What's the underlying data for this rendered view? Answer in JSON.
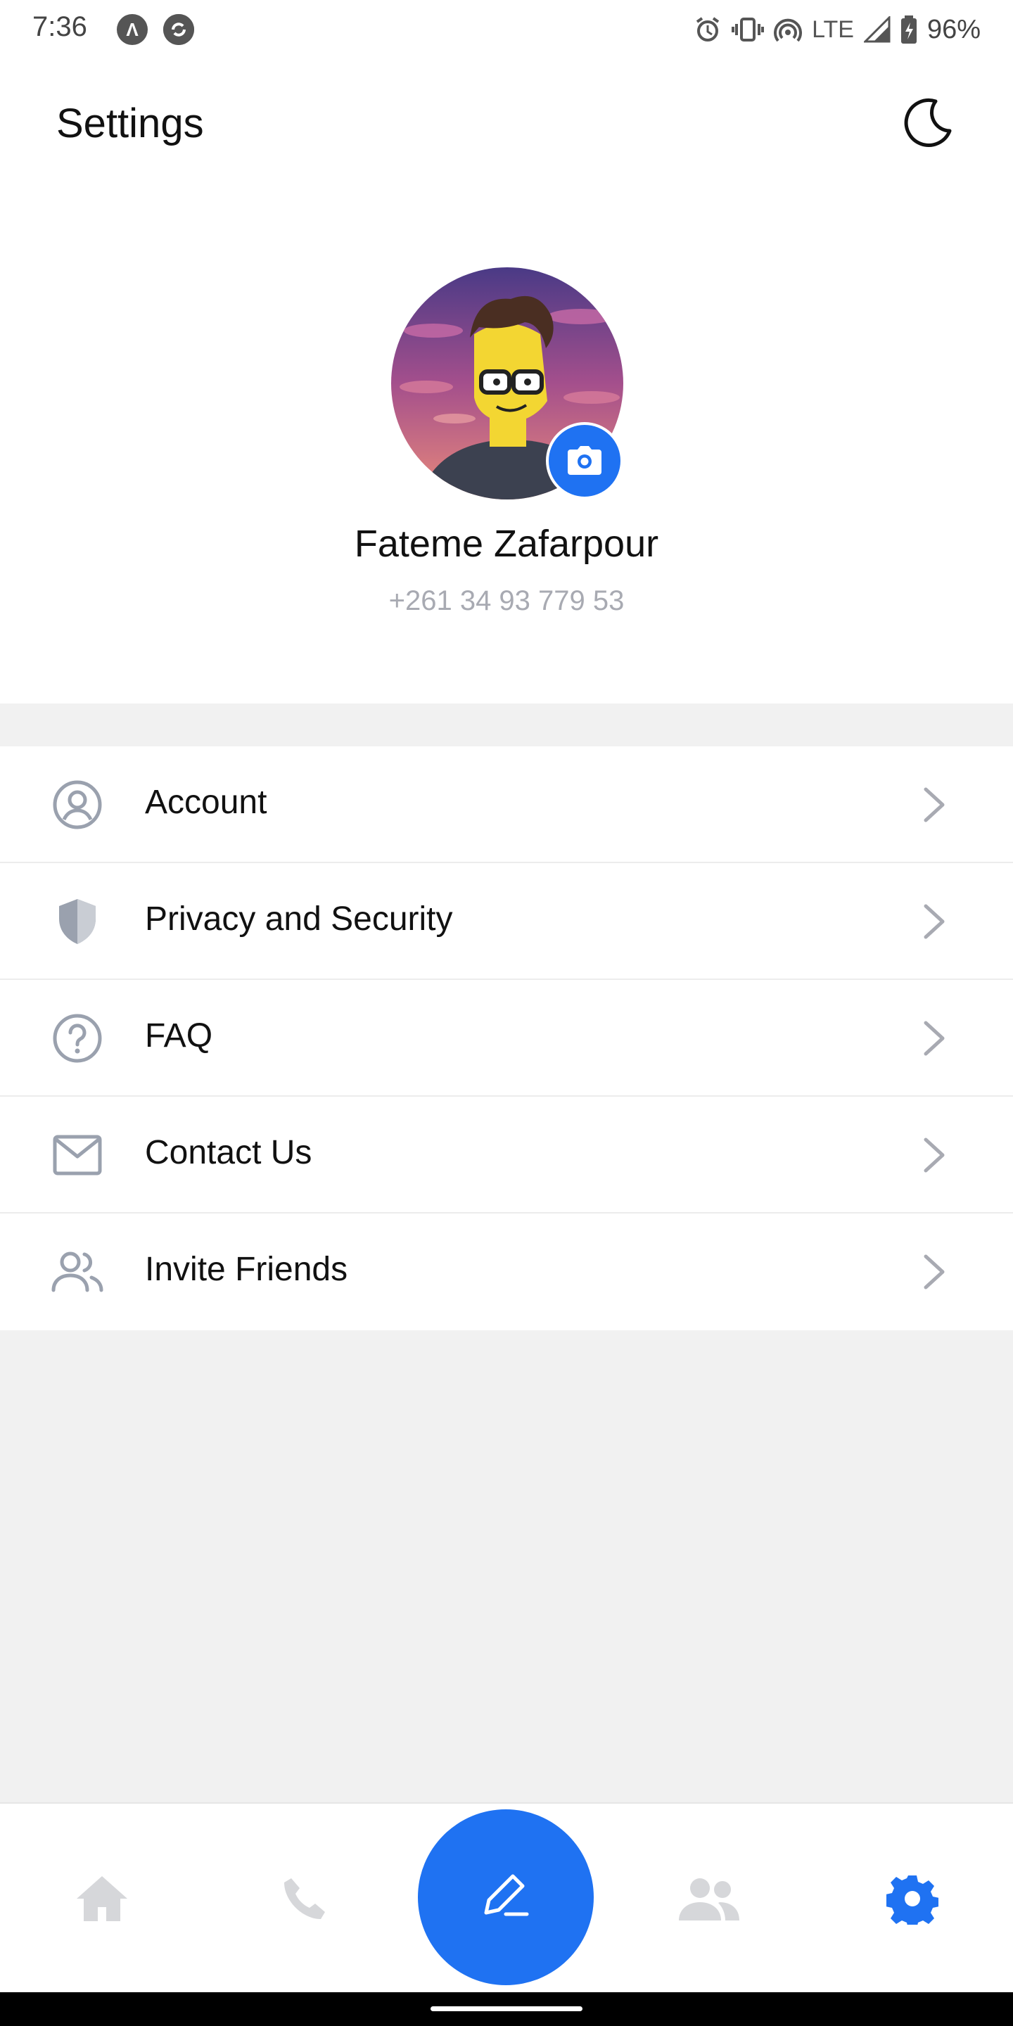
{
  "status_bar": {
    "time": "7:36",
    "network": "LTE",
    "battery": "96%",
    "icons_left": [
      "app-notification-icon",
      "sync-icon"
    ],
    "icons_right": [
      "alarm-icon",
      "vibrate-icon",
      "hotspot-icon",
      "signal-icon",
      "battery-icon"
    ]
  },
  "header": {
    "title": "Settings",
    "theme_toggle_icon": "moon-icon"
  },
  "profile": {
    "name": "Fateme Zafarpour",
    "phone": "+261 34 93 779 53",
    "avatar_icon": "avatar-image",
    "camera_icon": "camera-icon"
  },
  "menu": {
    "items": [
      {
        "label": "Account",
        "icon": "user-circle-icon"
      },
      {
        "label": "Privacy and Security",
        "icon": "shield-icon"
      },
      {
        "label": "FAQ",
        "icon": "question-circle-icon"
      },
      {
        "label": "Contact Us",
        "icon": "envelope-icon"
      },
      {
        "label": "Invite Friends",
        "icon": "users-icon"
      }
    ]
  },
  "bottom_nav": {
    "items": [
      "home-icon",
      "phone-icon",
      "compose-icon",
      "contacts-icon",
      "settings-icon"
    ],
    "active": "settings-icon"
  },
  "colors": {
    "accent": "#1f72f2",
    "background": "#f1f1f1",
    "surface": "#ffffff",
    "muted_text": "#a8aab2",
    "icon_gray": "#9aa1ae",
    "nav_inactive": "#d6d7da"
  }
}
